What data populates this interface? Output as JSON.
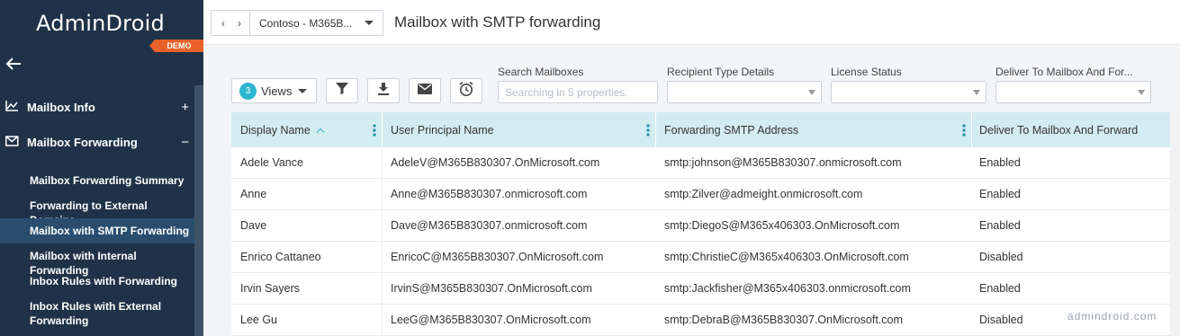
{
  "sidebar": {
    "logo": "AdminDroid",
    "demo_badge": "DEMO",
    "back_icon": "arrow-left-icon",
    "groups": [
      {
        "label": "Mailbox Info",
        "icon": "chart-line-icon",
        "toggle": "+"
      },
      {
        "label": "Mailbox Forwarding",
        "icon": "envelope-forward-icon",
        "toggle": "−"
      }
    ],
    "items": [
      {
        "label": "Mailbox Forwarding Summary",
        "active": false
      },
      {
        "label": "Forwarding to External Domains",
        "active": false
      },
      {
        "label": "Mailbox with SMTP Forwarding",
        "active": true
      },
      {
        "label": "Mailbox with Internal Forwarding",
        "active": false
      },
      {
        "label": "Inbox Rules with Forwarding",
        "active": false
      },
      {
        "label": "Inbox Rules with External Forwarding",
        "active": false
      }
    ]
  },
  "header": {
    "tenant": "Contoso - M365B...",
    "title": "Mailbox with SMTP forwarding"
  },
  "toolbar": {
    "views_count": "3",
    "views_label": "Views",
    "buttons": [
      "filter-icon",
      "download-icon",
      "email-icon",
      "alarm-clock-icon"
    ]
  },
  "filters": {
    "search_label": "Search Mailboxes",
    "search_placeholder": "Searching in 5 properties.",
    "recipient_label": "Recipient Type Details",
    "license_label": "License Status",
    "deliver_label": "Deliver To Mailbox And For..."
  },
  "table": {
    "columns": [
      "Display Name",
      "User Principal Name",
      "Forwarding SMTP Address",
      "Deliver To Mailbox And Forward"
    ],
    "sorted_column": "Display Name",
    "sort_direction": "ascending",
    "rows": [
      [
        "Adele Vance",
        "AdeleV@M365B830307.OnMicrosoft.com",
        "smtp:johnson@M365B830307.onmicrosoft.com",
        "Enabled"
      ],
      [
        "Anne",
        "Anne@M365B830307.onmicrosoft.com",
        "smtp:Zilver@admeight.onmicrosoft.com",
        "Enabled"
      ],
      [
        "Dave",
        "Dave@M365B830307.onmicrosoft.com",
        "smtp:DiegoS@M365x406303.OnMicrosoft.com",
        "Enabled"
      ],
      [
        "Enrico Cattaneo",
        "EnricoC@M365B830307.OnMicrosoft.com",
        "smtp:ChristieC@M365x406303.OnMicrosoft.com",
        "Disabled"
      ],
      [
        "Irvin Sayers",
        "IrvinS@M365B830307.OnMicrosoft.com",
        "smtp:Jackfisher@M365x406303.onmicrosoft.com",
        "Enabled"
      ],
      [
        "Lee Gu",
        "LeeG@M365B830307.OnMicrosoft.com",
        "smtp:DebraB@M365B830307.OnMicrosoft.com",
        "Disabled"
      ]
    ]
  },
  "watermark": "admindroid.com",
  "colors": {
    "sidebar_bg": "#1f3248",
    "active_item_bg": "#2a4d6e",
    "demo_badge": "#e8622a",
    "accent": "#2bb5cf",
    "table_header_bg": "#d3ecf1"
  }
}
